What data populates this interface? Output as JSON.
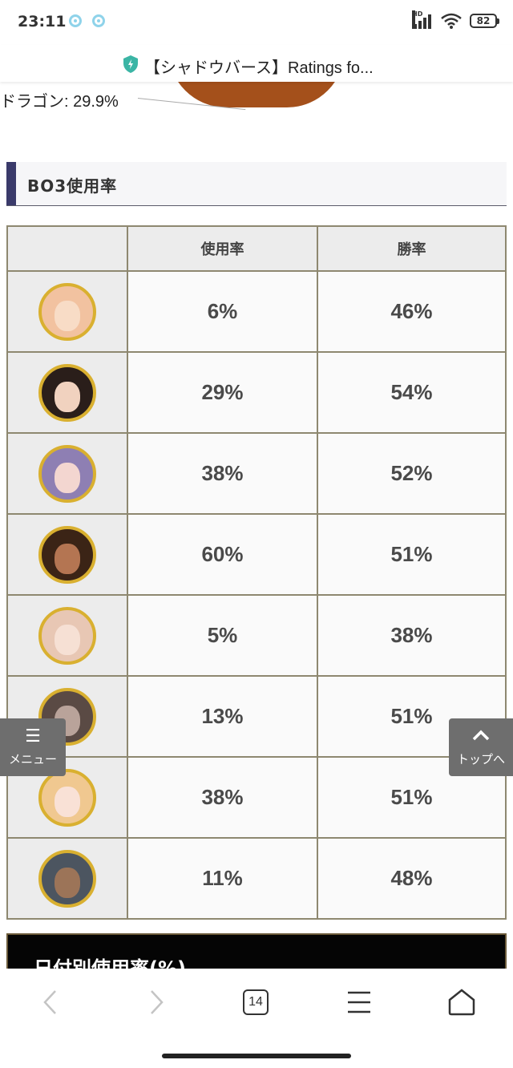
{
  "status_bar": {
    "time": "23:11",
    "battery": "82",
    "network": "HD"
  },
  "browser": {
    "page_title": "【シャドウバース】Ratings fo...",
    "tab_count": "14"
  },
  "pie_remnant": {
    "label": "ドラゴン: 29.9%",
    "color": "#a4501b"
  },
  "section": {
    "title": "BO3使用率"
  },
  "table": {
    "headers": [
      "",
      "使用率",
      "勝率"
    ],
    "rows": [
      {
        "icon": "elf-leader-avatar",
        "usage": "6%",
        "winrate": "46%"
      },
      {
        "icon": "royal-leader-avatar",
        "usage": "29%",
        "winrate": "54%"
      },
      {
        "icon": "witch-leader-avatar",
        "usage": "38%",
        "winrate": "52%"
      },
      {
        "icon": "dragon-leader-avatar",
        "usage": "60%",
        "winrate": "51%"
      },
      {
        "icon": "necro-leader-avatar",
        "usage": "5%",
        "winrate": "38%"
      },
      {
        "icon": "vampire-leader-avatar",
        "usage": "13%",
        "winrate": "51%"
      },
      {
        "icon": "bishop-leader-avatar",
        "usage": "38%",
        "winrate": "51%"
      },
      {
        "icon": "nemesis-leader-avatar",
        "usage": "11%",
        "winrate": "48%"
      }
    ]
  },
  "next_section": {
    "title": "日付別使用率(%)"
  },
  "floating": {
    "menu_label": "メニュー",
    "top_label": "トップへ"
  },
  "colors": {
    "accent_bar": "#3a3a6a",
    "table_border": "#8e8870",
    "avatar_ring": "#d9b030"
  }
}
